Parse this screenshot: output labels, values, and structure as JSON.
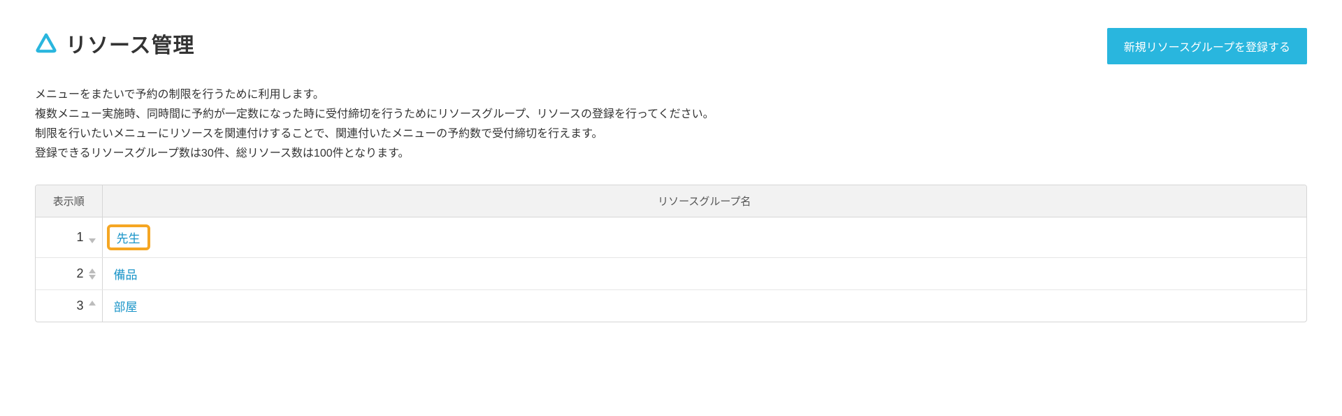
{
  "header": {
    "title": "リソース管理",
    "new_button_label": "新規リソースグループを登録する"
  },
  "description": {
    "line1": "メニューをまたいで予約の制限を行うために利用します。",
    "line2": "複数メニュー実施時、同時間に予約が一定数になった時に受付締切を行うためにリソースグループ、リソースの登録を行ってください。",
    "line3": "制限を行いたいメニューにリソースを関連付けすることで、関連付いたメニューの予約数で受付締切を行えます。",
    "line4": "登録できるリソースグループ数は30件、総リソース数は100件となります。"
  },
  "table": {
    "columns": {
      "order": "表示順",
      "name": "リソースグループ名"
    },
    "rows": [
      {
        "order": "1",
        "name": "先生",
        "highlighted": true,
        "can_up": false,
        "can_down": true
      },
      {
        "order": "2",
        "name": "備品",
        "highlighted": false,
        "can_up": true,
        "can_down": true
      },
      {
        "order": "3",
        "name": "部屋",
        "highlighted": false,
        "can_up": true,
        "can_down": false
      }
    ]
  },
  "colors": {
    "accent": "#29b6de",
    "link": "#1b95c8",
    "highlight_border": "#f5a623"
  }
}
